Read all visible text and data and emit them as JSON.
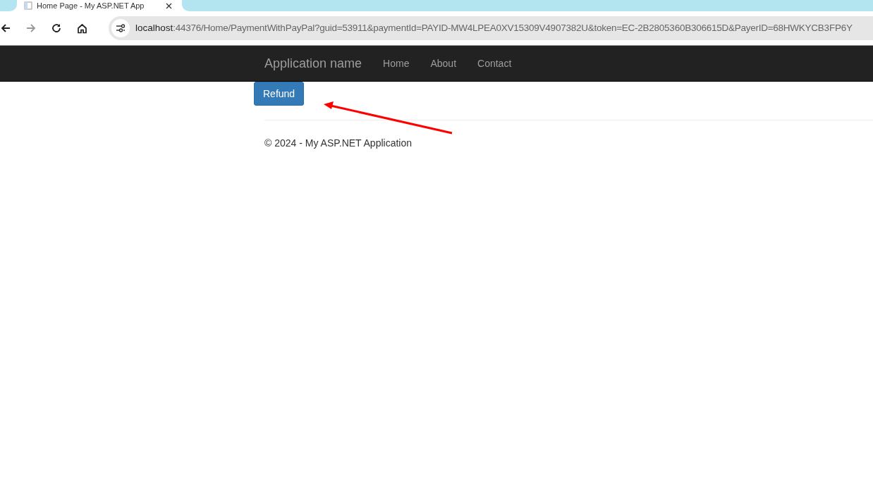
{
  "browser": {
    "tab_title": "Home Page - My ASP.NET App",
    "address_bar": {
      "host": "localhost",
      "rest": ":44376/Home/PaymentWithPayPal?guid=53911&paymentId=PAYID-MW4LPEA0XV15309V4907382U&token=EC-2B2805360B306615D&PayerID=68HWKYCB3FP6Y"
    }
  },
  "navbar": {
    "brand": "Application name",
    "links": [
      "Home",
      "About",
      "Contact"
    ]
  },
  "refund_button": "Refund",
  "footer": "© 2024 - My ASP.NET Application"
}
